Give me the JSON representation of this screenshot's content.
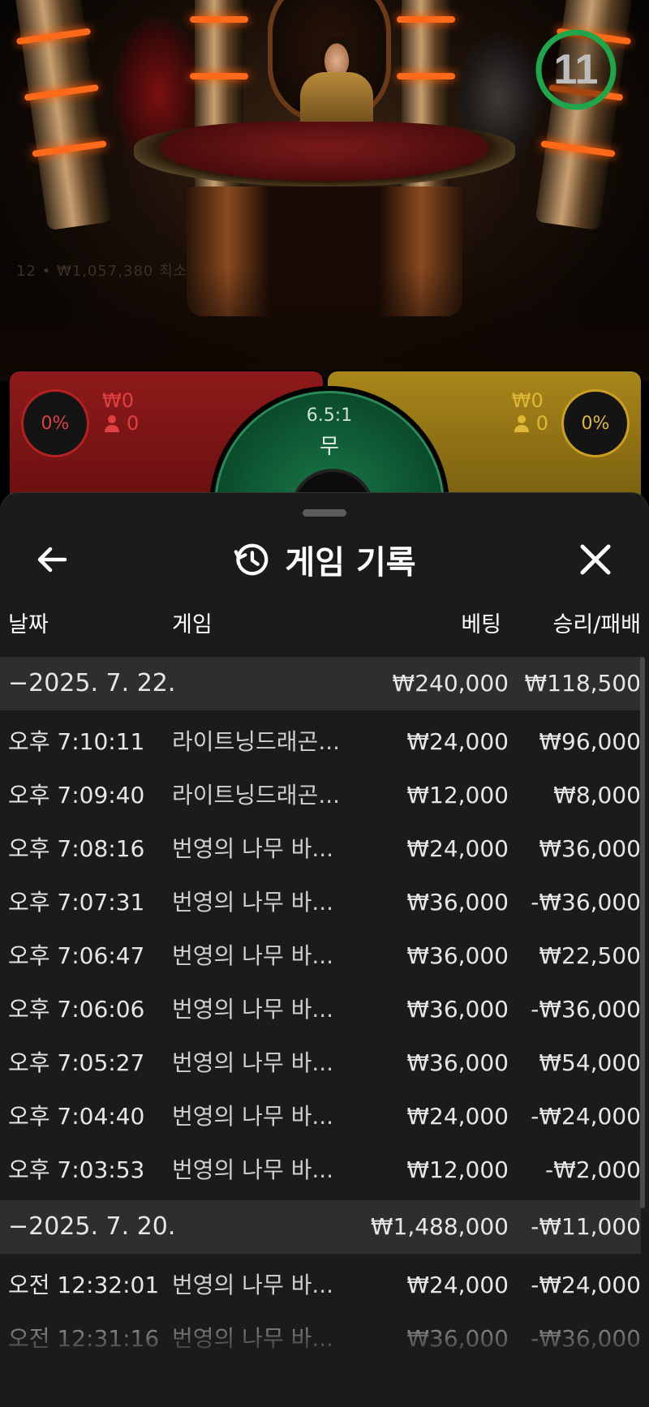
{
  "scene": {
    "timer": "11",
    "ghost_text": "12 • ₩1,057,380 최소"
  },
  "bet_panels": {
    "dragon": {
      "percent": "0%",
      "amount": "₩0",
      "players": "0"
    },
    "tiger": {
      "percent": "0%",
      "amount": "₩0",
      "players": "0"
    },
    "tie": {
      "odds": "6.5:1",
      "label": "무"
    }
  },
  "sheet": {
    "title": "게임 기록",
    "columns": {
      "date": "날짜",
      "game": "게임",
      "bet": "베팅",
      "win_loss": "승리/패배"
    },
    "rows": [
      {
        "type": "group",
        "date": "−2025. 7. 22.",
        "game": "",
        "bet": "₩240,000",
        "win_loss": "₩118,500"
      },
      {
        "type": "item",
        "date": "오후 7:10:11",
        "game": "라이트닝드래곤...",
        "bet": "₩24,000",
        "win_loss": "₩96,000"
      },
      {
        "type": "item",
        "date": "오후 7:09:40",
        "game": "라이트닝드래곤...",
        "bet": "₩12,000",
        "win_loss": "₩8,000"
      },
      {
        "type": "item",
        "date": "오후 7:08:16",
        "game": "번영의 나무 바...",
        "bet": "₩24,000",
        "win_loss": "₩36,000"
      },
      {
        "type": "item",
        "date": "오후 7:07:31",
        "game": "번영의 나무 바...",
        "bet": "₩36,000",
        "win_loss": "-₩36,000"
      },
      {
        "type": "item",
        "date": "오후 7:06:47",
        "game": "번영의 나무 바...",
        "bet": "₩36,000",
        "win_loss": "₩22,500"
      },
      {
        "type": "item",
        "date": "오후 7:06:06",
        "game": "번영의 나무 바...",
        "bet": "₩36,000",
        "win_loss": "-₩36,000"
      },
      {
        "type": "item",
        "date": "오후 7:05:27",
        "game": "번영의 나무 바...",
        "bet": "₩36,000",
        "win_loss": "₩54,000"
      },
      {
        "type": "item",
        "date": "오후 7:04:40",
        "game": "번영의 나무 바...",
        "bet": "₩24,000",
        "win_loss": "-₩24,000"
      },
      {
        "type": "item",
        "date": "오후 7:03:53",
        "game": "번영의 나무 바...",
        "bet": "₩12,000",
        "win_loss": "-₩2,000"
      },
      {
        "type": "group",
        "date": "−2025. 7. 20.",
        "game": "",
        "bet": "₩1,488,000",
        "win_loss": "-₩11,000"
      },
      {
        "type": "item",
        "date": "오전 12:32:01",
        "game": "번영의 나무 바...",
        "bet": "₩24,000",
        "win_loss": "-₩24,000"
      },
      {
        "type": "item",
        "date": "오전 12:31:16",
        "game": "번영의 나무 바...",
        "bet": "₩36,000",
        "win_loss": "-₩36,000"
      }
    ]
  },
  "colors": {
    "sheet_bg": "#1b1b1b",
    "group_row_bg": "#2e2e2e",
    "timer_ring": "#1fa64a",
    "dragon": "#8e1a1a",
    "tiger": "#a8861a",
    "tie": "#1a7a4a"
  }
}
